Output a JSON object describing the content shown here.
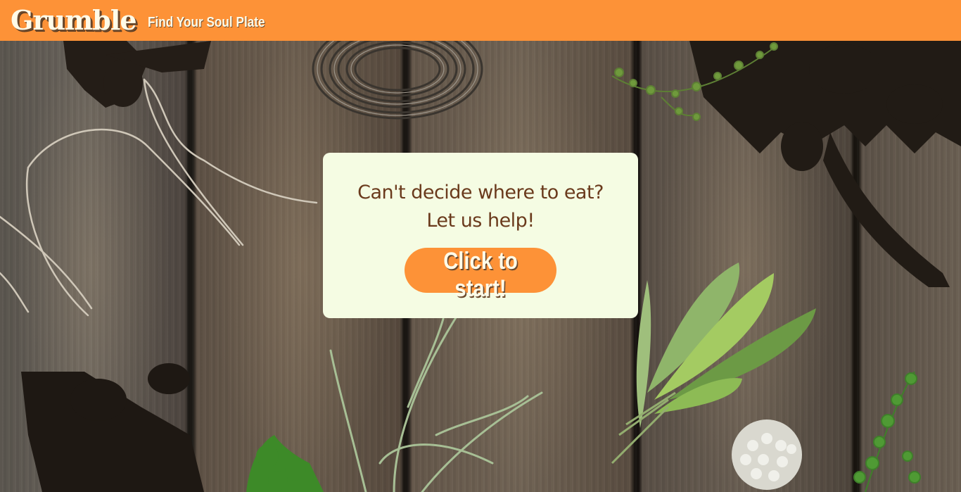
{
  "nav": {
    "logo": "Grumble",
    "tagline": "Find Your Soul Plate"
  },
  "card": {
    "line1": "Can't decide where to eat?",
    "line2": "Let us help!",
    "button_label": "Click to start!"
  },
  "colors": {
    "brand_orange": "#fd9237",
    "card_background": "#f5fce3",
    "headline_brown": "#6a3a1c",
    "logo_cream": "#fffbe8"
  },
  "background": {
    "image_icon": "rustic-wood-herbs-photo"
  }
}
